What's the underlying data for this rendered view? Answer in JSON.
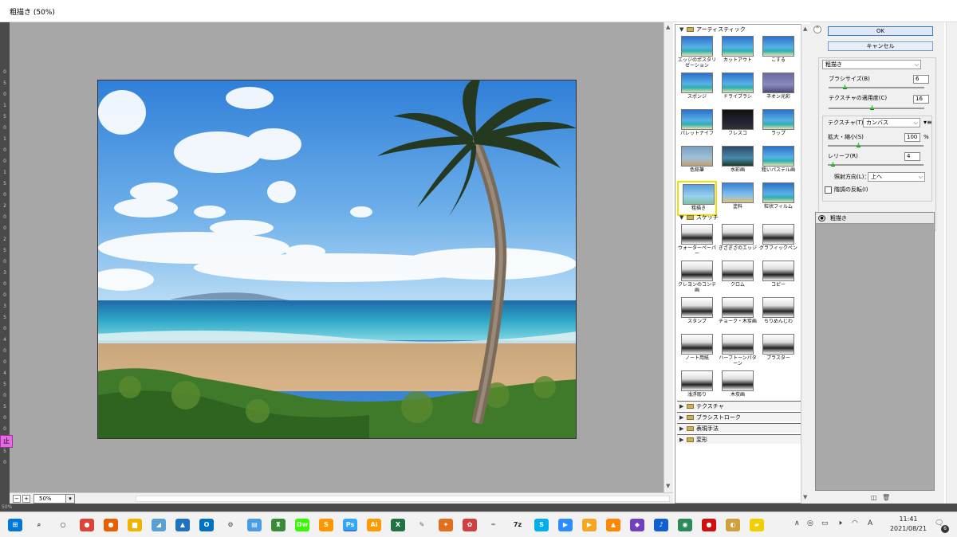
{
  "window": {
    "title": "粗描き (50%)"
  },
  "ruler_left": [
    "0",
    "5",
    "0",
    "1",
    "5",
    "0",
    "1",
    "0",
    "0",
    "1",
    "5",
    "0",
    "2",
    "0",
    "0",
    "2",
    "5",
    "0",
    "3",
    "0",
    "0",
    "3",
    "5",
    "0",
    "4",
    "0",
    "0",
    "4",
    "5",
    "0",
    "5",
    "0",
    "0",
    "5",
    "5",
    "0"
  ],
  "side_tag": "止",
  "zoom": {
    "value": "50%",
    "minus": "−",
    "plus": "+",
    "dropdown": "▾"
  },
  "statusbar": {
    "text": "50%"
  },
  "gallery": {
    "categories": [
      {
        "name": "アーティスティック",
        "open": true
      },
      {
        "name": "スケッチ",
        "open": true
      },
      {
        "name": "テクスチャ",
        "open": false
      },
      {
        "name": "ブラシストローク",
        "open": false
      },
      {
        "name": "表現手法",
        "open": false
      },
      {
        "name": "変形",
        "open": false
      }
    ],
    "artistic": [
      "エッジのポスタリゼーション",
      "カットアウト",
      "こする",
      "スポンジ",
      "ドライブラシ",
      "ネオン光彩",
      "パレットナイフ",
      "フレスコ",
      "ラップ",
      "色鉛筆",
      "水彩画",
      "粗いパステル画",
      "粗描き",
      "塗料",
      "粒状フィルム"
    ],
    "sketch": [
      "ウォーターペーパー",
      "ぎざぎざのエッジ",
      "グラフィックペン",
      "クレヨンのコンテ画",
      "クロム",
      "コピー",
      "スタンプ",
      "チョーク・木炭画",
      "ちりめんじわ",
      "ノート用紙",
      "ハーフトーンパターン",
      "プラスター",
      "浅浮彫り",
      "木炭画"
    ],
    "selected": "粗描き"
  },
  "panel": {
    "ok": "OK",
    "cancel": "キャンセル",
    "collapse": "^",
    "filter_select": "粗描き",
    "brush_size_label": "ブラシサイズ(B)",
    "brush_size": "6",
    "texture_coverage_label": "テクスチャの適用度(C)",
    "texture_coverage": "16",
    "texture_label": "テクスチャ(T)：",
    "texture_value": "カンバス",
    "scaling_label": "拡大・縮小(S)",
    "scaling": "100",
    "scaling_unit": "%",
    "relief_label": "レリーフ(R)",
    "relief": "4",
    "light_label": "照射方向(L)：",
    "light_value": "上へ",
    "invert_label": "階調の反転(I)",
    "layer_name": "粗描き"
  },
  "taskbar": {
    "icons": [
      {
        "name": "windows-icon",
        "glyph": "⊞",
        "color": "#0078d7"
      },
      {
        "name": "search-icon",
        "glyph": "⌕",
        "color": "#333"
      },
      {
        "name": "cortana-icon",
        "glyph": "○",
        "color": "#333"
      },
      {
        "name": "chrome-icon",
        "glyph": "●",
        "color": "#db4437"
      },
      {
        "name": "firefox-icon",
        "glyph": "●",
        "color": "#e66000"
      },
      {
        "name": "explorer-icon",
        "glyph": "▆",
        "color": "#f0b400"
      },
      {
        "name": "app-icon",
        "glyph": "◢",
        "color": "#5aa0d0"
      },
      {
        "name": "photos-icon",
        "glyph": "▲",
        "color": "#1e73be"
      },
      {
        "name": "outlook-icon",
        "glyph": "O",
        "color": "#0072c6"
      },
      {
        "name": "settings-icon",
        "glyph": "⚙",
        "color": "#444"
      },
      {
        "name": "news-icon",
        "glyph": "▤",
        "color": "#4a9de0"
      },
      {
        "name": "app2-icon",
        "glyph": "♜",
        "color": "#3a8a3a"
      },
      {
        "name": "dreamweaver-icon",
        "glyph": "Dw",
        "color": "#35fa00"
      },
      {
        "name": "sublime-icon",
        "glyph": "S",
        "color": "#ff9800"
      },
      {
        "name": "photoshop-icon",
        "glyph": "Ps",
        "color": "#31a8ff"
      },
      {
        "name": "illustrator-icon",
        "glyph": "Ai",
        "color": "#ff9a00"
      },
      {
        "name": "excel-icon",
        "glyph": "X",
        "color": "#217346"
      },
      {
        "name": "app3-icon",
        "glyph": "✎",
        "color": "#666"
      },
      {
        "name": "butterfly-icon",
        "glyph": "✦",
        "color": "#e07020"
      },
      {
        "name": "app4-icon",
        "glyph": "✿",
        "color": "#d04040"
      },
      {
        "name": "pen-icon",
        "glyph": "✒",
        "color": "#888"
      },
      {
        "name": "7zip-icon",
        "glyph": "7z",
        "color": "#222"
      },
      {
        "name": "skype-icon",
        "glyph": "S",
        "color": "#00aff0"
      },
      {
        "name": "zoom-icon",
        "glyph": "▶",
        "color": "#2d8cff"
      },
      {
        "name": "media-icon",
        "glyph": "▶",
        "color": "#f5a623"
      },
      {
        "name": "vlc-icon",
        "glyph": "▲",
        "color": "#ff8800"
      },
      {
        "name": "app5-icon",
        "glyph": "◆",
        "color": "#7040c0"
      },
      {
        "name": "music-icon",
        "glyph": "♪",
        "color": "#1060d0"
      },
      {
        "name": "app6-icon",
        "glyph": "◉",
        "color": "#2a8a5a"
      },
      {
        "name": "record-icon",
        "glyph": "●",
        "color": "#d01010"
      },
      {
        "name": "app7-icon",
        "glyph": "◐",
        "color": "#d0a040"
      },
      {
        "name": "sticky-icon",
        "glyph": "▰",
        "color": "#f0d000"
      }
    ],
    "clock_time": "11:41",
    "clock_date": "2021/08/21",
    "ime": "A",
    "notifications": "6"
  }
}
